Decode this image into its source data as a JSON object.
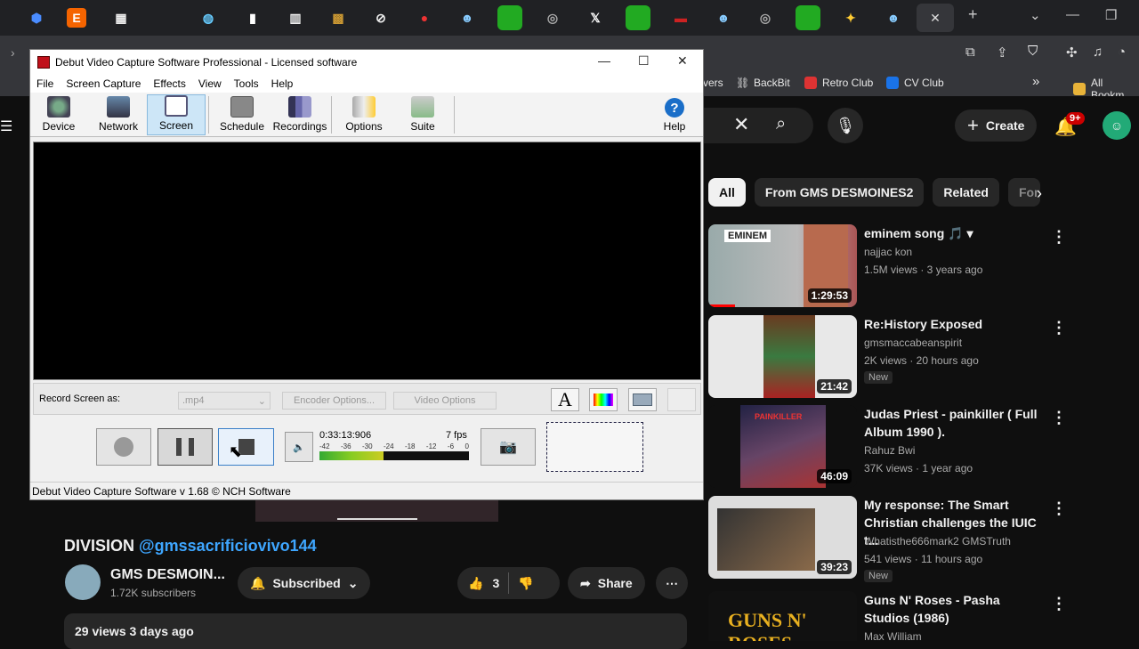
{
  "browser": {
    "close_tab": "✕",
    "new_tab": "+",
    "bookmarks": [
      {
        "label": "vers",
        "color": "#444"
      },
      {
        "label": "BackBit",
        "color": "#ddd"
      },
      {
        "label": "Retro Club",
        "color": "#d33"
      },
      {
        "label": "CV Club",
        "color": "#1a73e8"
      },
      {
        "label": "All Bookm",
        "color": "#e8b339"
      }
    ],
    "more_bookmarks": "»"
  },
  "youtube": {
    "create_label": "Create",
    "notif_count": "9+",
    "chips": [
      "All",
      "From GMS DESMOINES2",
      "Related",
      "For"
    ],
    "videos": [
      {
        "title": "eminem song 🎵 ▾",
        "channel": "najjac kon",
        "meta": "1.5M views · 3 years ago",
        "duration": "1:29:53",
        "thumb_text": "EMINEM",
        "new": false
      },
      {
        "title": "Re:History Exposed",
        "channel": "gmsmaccabeanspirit",
        "meta": "2K views · 20 hours ago",
        "duration": "21:42",
        "thumb_text": "",
        "new": true
      },
      {
        "title": "Judas Priest - painkiller ( Full Album 1990 ).",
        "channel": "Rahuz Bwi",
        "meta": "37K views · 1 year ago",
        "duration": "46:09",
        "thumb_text": "PAINKILLER",
        "new": false
      },
      {
        "title": "My response: The Smart Christian challenges the IUIC t...",
        "channel": "Whatisthe666mark2 GMSTruth",
        "meta": "541 views · 11 hours ago",
        "duration": "39:23",
        "thumb_text": "",
        "new": true
      },
      {
        "title": "Guns N' Roses - Pasha Studios (1986)",
        "channel": "Max William",
        "meta": "",
        "duration": "",
        "thumb_text": "GUNS N' ROSES",
        "new": false
      }
    ],
    "new_badge": "New",
    "video_title_prefix": "DIVISION ",
    "video_title_handle": "@gmssacrificiovivo144",
    "channel_name": "GMS DESMOIN...",
    "subscribers": "1.72K subscribers",
    "subscribed_label": "Subscribed",
    "like_count": "3",
    "share_label": "Share",
    "desc_stats": "29 views  3 days ago"
  },
  "debut": {
    "title": "Debut Video Capture Software Professional - Licensed software",
    "menu": [
      "File",
      "Screen Capture",
      "Effects",
      "View",
      "Tools",
      "Help"
    ],
    "toolbar": [
      "Device",
      "Network",
      "Screen",
      "Schedule",
      "Recordings",
      "Options",
      "Suite",
      "Help"
    ],
    "record_as_label": "Record Screen as:",
    "format_value": ".mp4",
    "encoder_btn": "Encoder Options...",
    "video_btn": "Video Options",
    "time": "0:33:13:906",
    "fps": "7 fps",
    "meter_ticks": [
      "-42",
      "-36",
      "-30",
      "-24",
      "-18",
      "-12",
      "-6",
      "0"
    ],
    "status": "Debut Video Capture Software v 1.68 © NCH Software",
    "level_fraction": 0.43,
    "text_icon": "A"
  }
}
